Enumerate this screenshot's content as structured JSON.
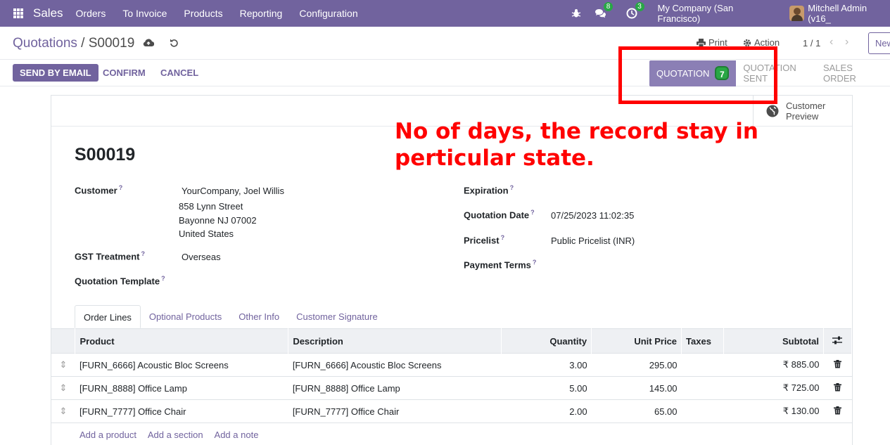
{
  "navbar": {
    "app_name": "Sales",
    "menu": [
      "Orders",
      "To Invoice",
      "Products",
      "Reporting",
      "Configuration"
    ],
    "messages_count": "8",
    "activities_count": "3",
    "company": "My Company (San Francisco)",
    "user": "Mitchell Admin (v16_"
  },
  "control_panel": {
    "breadcrumb_parent": "Quotations",
    "breadcrumb_separator": " / ",
    "breadcrumb_current": "S00019",
    "print_label": "Print",
    "action_label": "Action",
    "pager": "1 / 1",
    "new_label": "New"
  },
  "status": {
    "send_email": "SEND BY EMAIL",
    "confirm": "CONFIRM",
    "cancel": "CANCEL",
    "active_stage": "QUOTATION",
    "active_stage_days": "7",
    "stages": [
      "QUOTATION SENT",
      "SALES ORDER"
    ]
  },
  "annotation": "No of days, the record stay in perticular state.",
  "sheet": {
    "customer_preview": [
      "Customer",
      "Preview"
    ],
    "title": "S00019",
    "customer_label": "Customer",
    "customer_name": "YourCompany, Joel Willis",
    "address": [
      "858 Lynn Street",
      "Bayonne NJ 07002",
      "United States"
    ],
    "gst_label": "GST Treatment",
    "gst_value": "Overseas",
    "template_label": "Quotation Template",
    "expiration_label": "Expiration",
    "quotation_date_label": "Quotation Date",
    "quotation_date_value": "07/25/2023 11:02:35",
    "pricelist_label": "Pricelist",
    "pricelist_value": "Public Pricelist (INR)",
    "payment_terms_label": "Payment Terms",
    "help_mark": "?"
  },
  "tabs": [
    "Order Lines",
    "Optional Products",
    "Other Info",
    "Customer Signature"
  ],
  "order_lines": {
    "headers": [
      "Product",
      "Description",
      "Quantity",
      "Unit Price",
      "Taxes",
      "Subtotal"
    ],
    "rows": [
      {
        "product": "[FURN_6666] Acoustic Bloc Screens",
        "description": "[FURN_6666] Acoustic Bloc Screens",
        "quantity": "3.00",
        "unit_price": "295.00",
        "taxes": "",
        "subtotal": "₹ 885.00"
      },
      {
        "product": "[FURN_8888] Office Lamp",
        "description": "[FURN_8888] Office Lamp",
        "quantity": "5.00",
        "unit_price": "145.00",
        "taxes": "",
        "subtotal": "₹ 725.00"
      },
      {
        "product": "[FURN_7777] Office Chair",
        "description": "[FURN_7777] Office Chair",
        "quantity": "2.00",
        "unit_price": "65.00",
        "taxes": "",
        "subtotal": "₹ 130.00"
      }
    ],
    "add_links": [
      "Add a product",
      "Add a section",
      "Add a note"
    ]
  }
}
